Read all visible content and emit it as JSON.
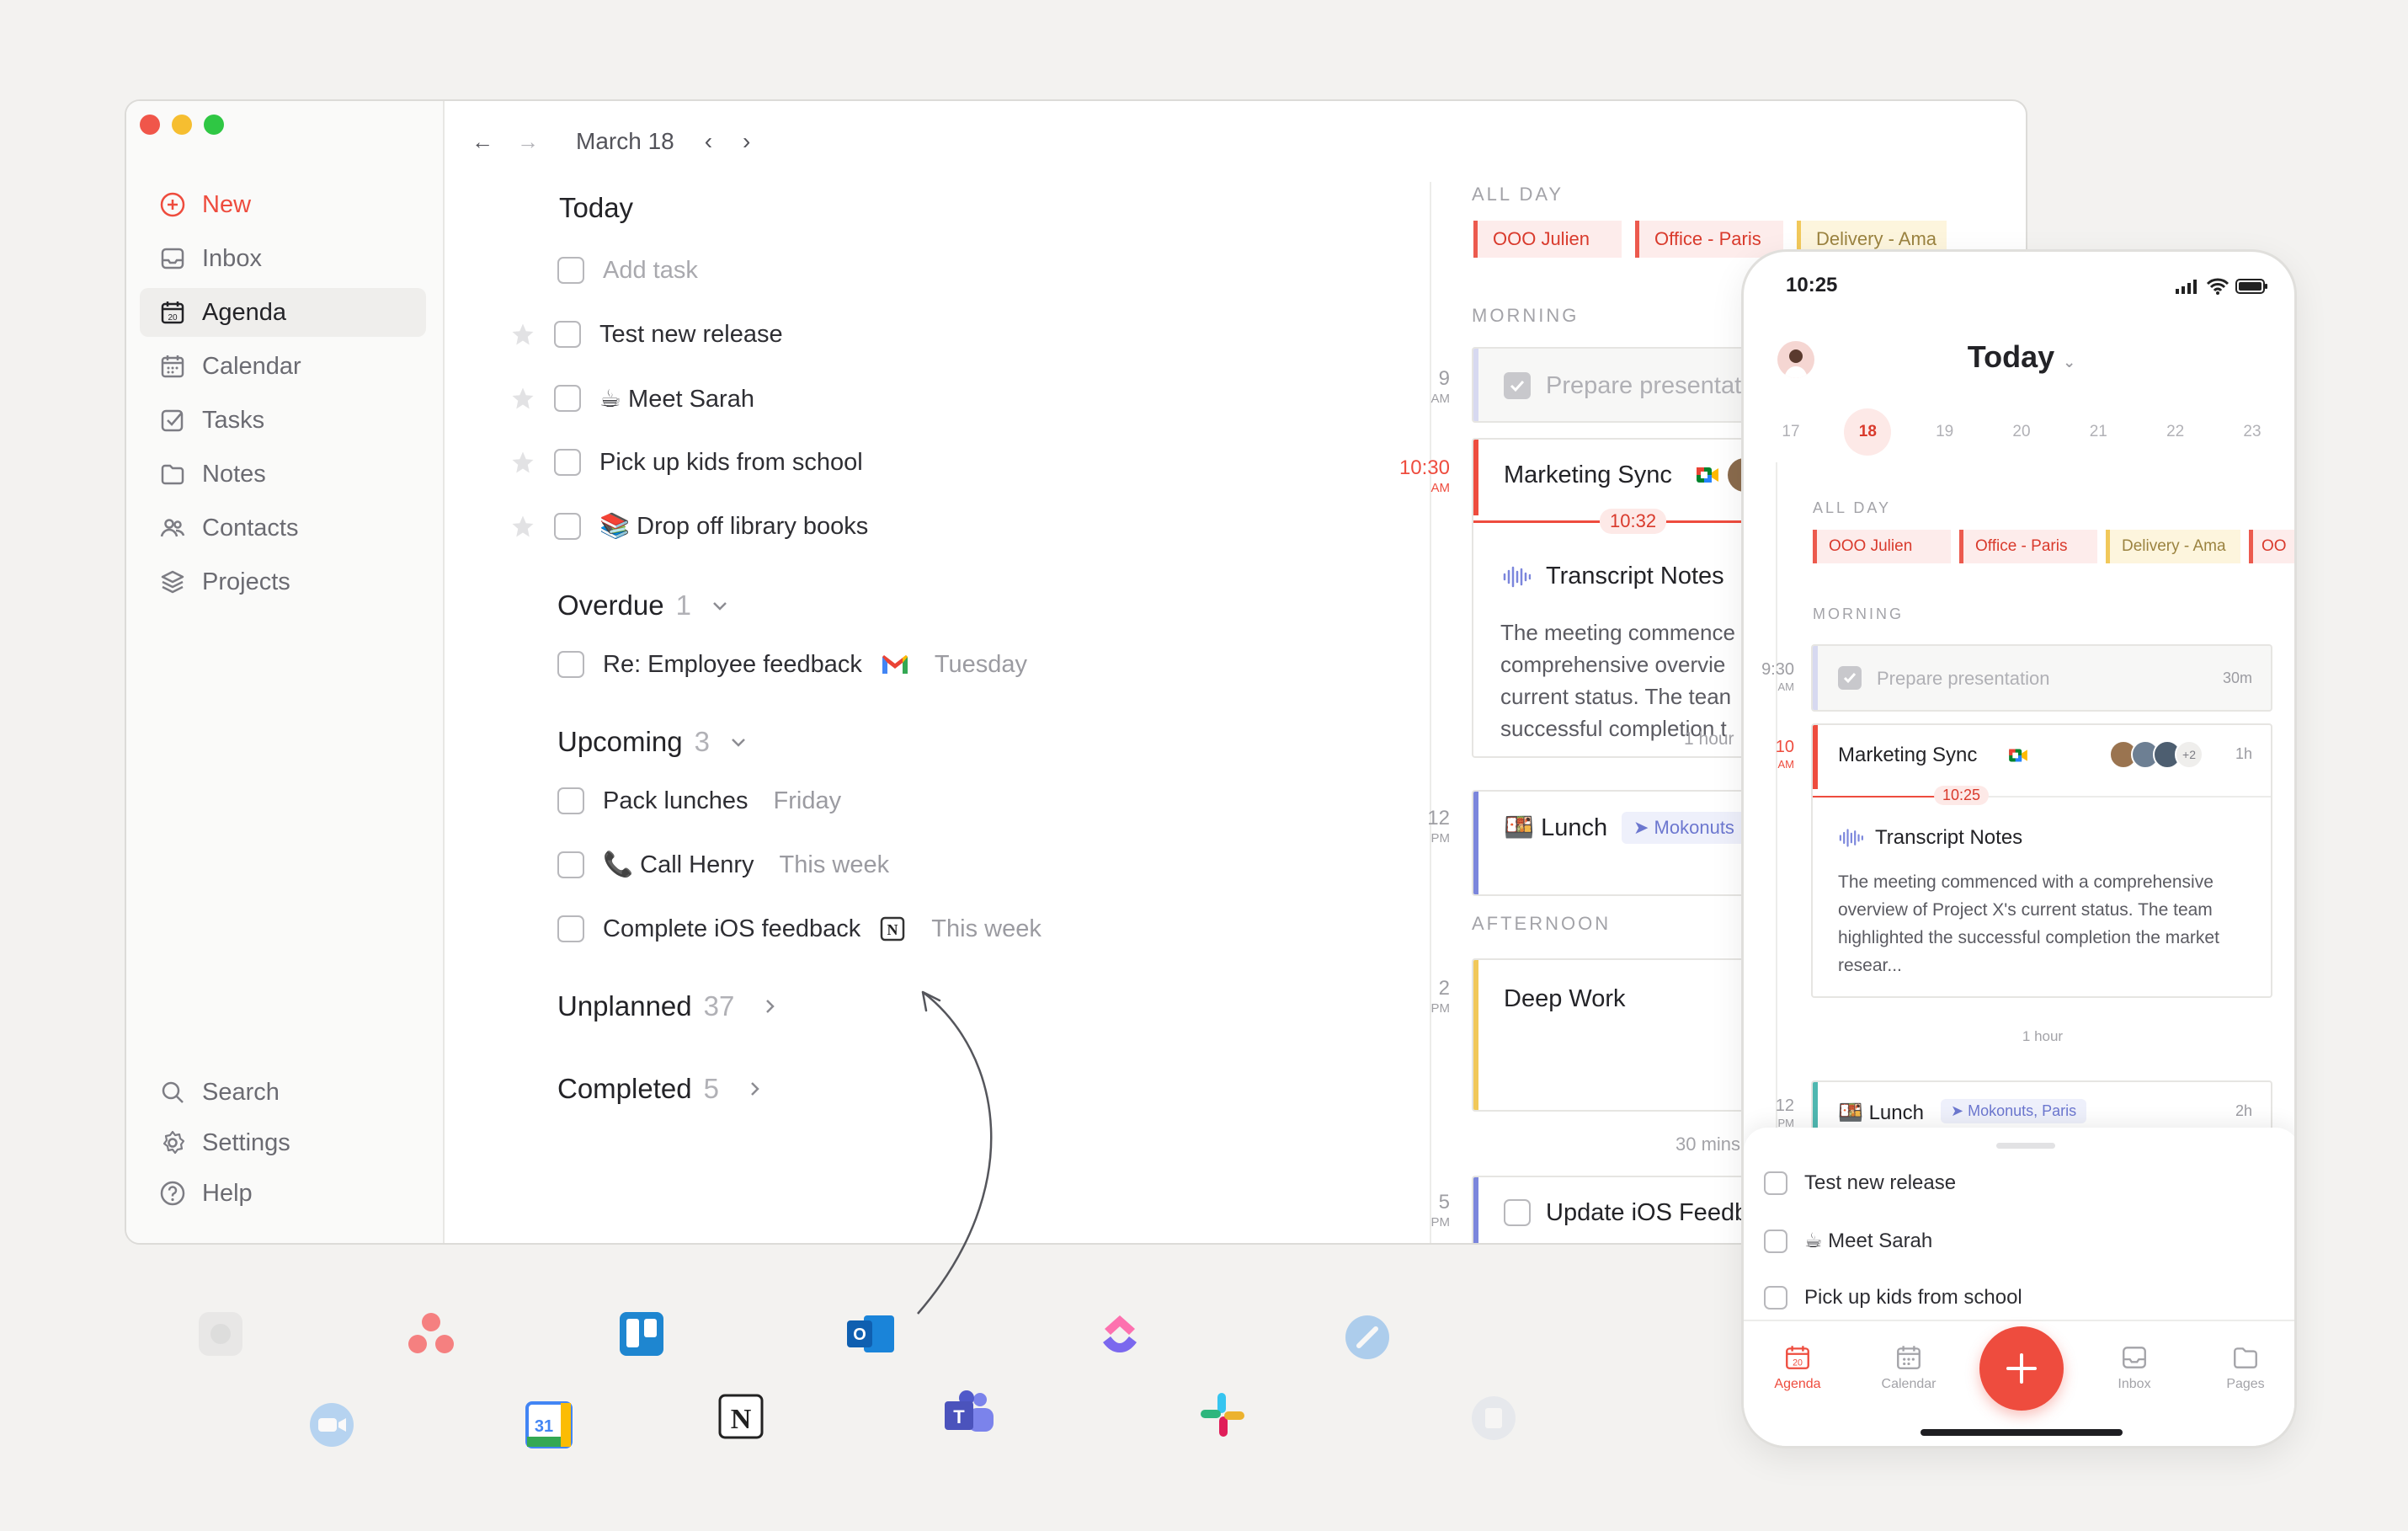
{
  "window": {
    "sidebar": {
      "new": "New",
      "inbox": "Inbox",
      "agenda": "Agenda",
      "calendar": "Calendar",
      "tasks": "Tasks",
      "notes": "Notes",
      "contacts": "Contacts",
      "projects": "Projects",
      "search": "Search",
      "settings": "Settings",
      "help": "Help"
    },
    "topbar": {
      "date": "March 18"
    },
    "today": {
      "title": "Today",
      "add_task": "Add task",
      "tasks": [
        "Test new release",
        "☕ Meet Sarah",
        "Pick up kids from school",
        "📚 Drop off library books"
      ]
    },
    "overdue": {
      "title": "Overdue",
      "count": "1",
      "task": "Re: Employee feedback",
      "meta": "Tuesday"
    },
    "upcoming": {
      "title": "Upcoming",
      "count": "3",
      "tasks": [
        {
          "label": "Pack lunches",
          "meta": "Friday"
        },
        {
          "label": "📞 Call Henry",
          "meta": "This week"
        },
        {
          "label": "Complete iOS feedback",
          "meta": "This week"
        }
      ]
    },
    "unplanned": {
      "title": "Unplanned",
      "count": "37"
    },
    "completed": {
      "title": "Completed",
      "count": "5"
    }
  },
  "agenda": {
    "all_day_label": "ALL DAY",
    "chips": [
      "OOO Julien",
      "Office - Paris",
      "Delivery - Ama"
    ],
    "morning_label": "MORNING",
    "afternoon_label": "AFTERNOON",
    "hours": [
      {
        "h": "9",
        "p": "AM"
      },
      {
        "h": "10:30",
        "p": "AM"
      },
      {
        "h": "12",
        "p": "PM"
      },
      {
        "h": "2",
        "p": "PM"
      },
      {
        "h": "5",
        "p": "PM"
      }
    ],
    "now": "10:32",
    "events": {
      "prepare": "Prepare presentati",
      "sync": "Marketing Sync",
      "notes_title": "Transcript Notes",
      "notes_lines": [
        "The meeting commence",
        "comprehensive overvie",
        "current status. The tean",
        "successful completion t"
      ],
      "notes_duration": "1 hour",
      "lunch": "Lunch",
      "lunch_place": "Mokonuts",
      "deep_work": "Deep Work",
      "deep_duration": "30 mins",
      "ios": "Update iOS Feedb"
    }
  },
  "phone": {
    "time": "10:25",
    "title": "Today",
    "days": [
      "17",
      "18",
      "19",
      "20",
      "21",
      "22",
      "23"
    ],
    "all_day_label": "ALL DAY",
    "chips": [
      "OOO Julien",
      "Office - Paris",
      "Delivery - Ama",
      "OO"
    ],
    "morning_label": "MORNING",
    "hours": [
      {
        "h": "9:30",
        "p": "AM"
      },
      {
        "h": "10",
        "p": "AM"
      },
      {
        "h": "12",
        "p": "PM"
      }
    ],
    "prepare": "Prepare presentation",
    "prepare_dur": "30m",
    "sync": "Marketing Sync",
    "sync_more": "+2",
    "sync_dur": "1h",
    "now": "10:25",
    "notes_title": "Transcript Notes",
    "notes_body": "The meeting commenced with a comprehensive overview of Project X's current status. The team highlighted the successful completion the market resear...",
    "gap": "1 hour",
    "lunch": "Lunch",
    "lunch_place": "Mokonuts, Paris",
    "lunch_dur": "2h",
    "sheet_tasks": [
      "Test new release",
      "☕ Meet Sarah",
      "Pick up kids from school"
    ],
    "tabs": [
      "Agenda",
      "Calendar",
      "Inbox",
      "Pages"
    ],
    "tab_date": "20"
  },
  "icons": {
    "gcal_day": "31",
    "outlook": "O",
    "teams": "T",
    "notion": "N"
  },
  "colors": {
    "accent": "#ee4c3e",
    "brand_blue": "#7b86dc",
    "yellow": "#f1c85a"
  }
}
